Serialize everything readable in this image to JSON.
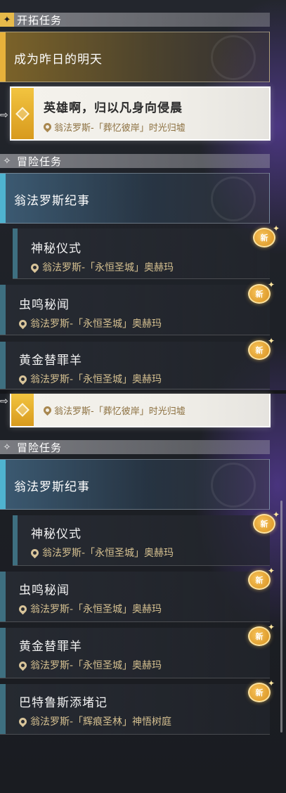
{
  "panel_top": {
    "pioneer_header": "开拓任务",
    "pioneer_chapter": "成为昨日的明天",
    "active_quest": {
      "title": "英雄啊，归以凡身向侵晨",
      "location": "翁法罗斯-「葬忆彼岸」时光归墟"
    },
    "adventure_header": "冒险任务",
    "adventure_group": "翁法罗斯纪事",
    "quests": [
      {
        "title": "神秘仪式",
        "location": "翁法罗斯-「永恒圣城」奥赫玛",
        "badge": "新"
      },
      {
        "title": "虫鸣秘闻",
        "location": "翁法罗斯-「永恒圣城」奥赫玛",
        "badge": "新"
      },
      {
        "title": "黄金替罪羊",
        "location": "翁法罗斯-「永恒圣城」奥赫玛",
        "badge": "新"
      }
    ]
  },
  "panel_bottom": {
    "active_quest_location": "翁法罗斯-「葬忆彼岸」时光归墟",
    "adventure_header": "冒险任务",
    "adventure_group": "翁法罗斯纪事",
    "quests": [
      {
        "title": "神秘仪式",
        "location": "翁法罗斯-「永恒圣城」奥赫玛",
        "badge": "新"
      },
      {
        "title": "虫鸣秘闻",
        "location": "翁法罗斯-「永恒圣城」奥赫玛",
        "badge": "新"
      },
      {
        "title": "黄金替罪羊",
        "location": "翁法罗斯-「永恒圣城」奥赫玛",
        "badge": "新"
      },
      {
        "title": "巴特鲁斯添堵记",
        "location": "翁法罗斯-「辉痕圣林」神悟树庭",
        "badge": "新"
      }
    ]
  },
  "colors": {
    "pioneer_gold": "#e6b13b",
    "adventure_blue": "#4fb3d0",
    "location_text": "#d6c191",
    "new_badge": "#e9a832"
  },
  "icons": [
    "pioneer-quest-icon",
    "adventure-quest-icon",
    "location-pin-icon",
    "new-badge-icon",
    "track-arrow-icon"
  ]
}
